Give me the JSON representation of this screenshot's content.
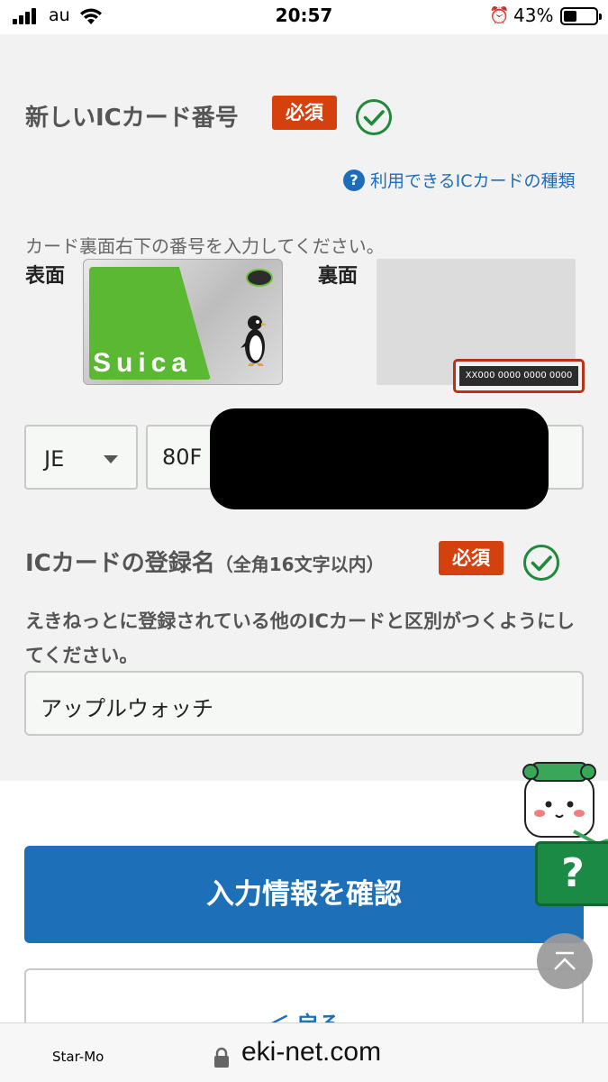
{
  "status_bar": {
    "carrier": "au",
    "time": "20:57",
    "battery_percent": "43%",
    "battery_level": 0.43,
    "icons": [
      "signal-icon",
      "wifi-icon",
      "alarm-icon",
      "battery-icon"
    ]
  },
  "form": {
    "ic_number_section": {
      "title": "新しいICカード番号",
      "required": "必須",
      "valid": true,
      "help_link": "利用できるICカードの種類",
      "instruction": "カード裏面右下の番号を入力してください。",
      "front_label": "表面",
      "back_label": "裏面",
      "card_logo": "Suica",
      "back_number_sample": "XX000 0000 0000 0000",
      "prefix_value": "JE",
      "number_value": "80F"
    },
    "ic_name_section": {
      "title": "ICカードの登録名",
      "title_sub": "（全角16文字以内）",
      "required": "必須",
      "valid": true,
      "description": "えきねっとに登録されている他のICカードと区別がつくようにしてください。",
      "name_value": "アップルウォッチ"
    }
  },
  "actions": {
    "confirm_label": "入力情報を確認",
    "back_label": "＜ 戻る",
    "help_fab": "?"
  },
  "browser": {
    "left_label": "Star-Mo",
    "url": "eki-net.com"
  },
  "colors": {
    "required_badge": "#d4410f",
    "check_green": "#1f8a3b",
    "primary_blue": "#1d6fb8",
    "help_green": "#1b8a45",
    "panel_bg": "#f2f2f2"
  }
}
